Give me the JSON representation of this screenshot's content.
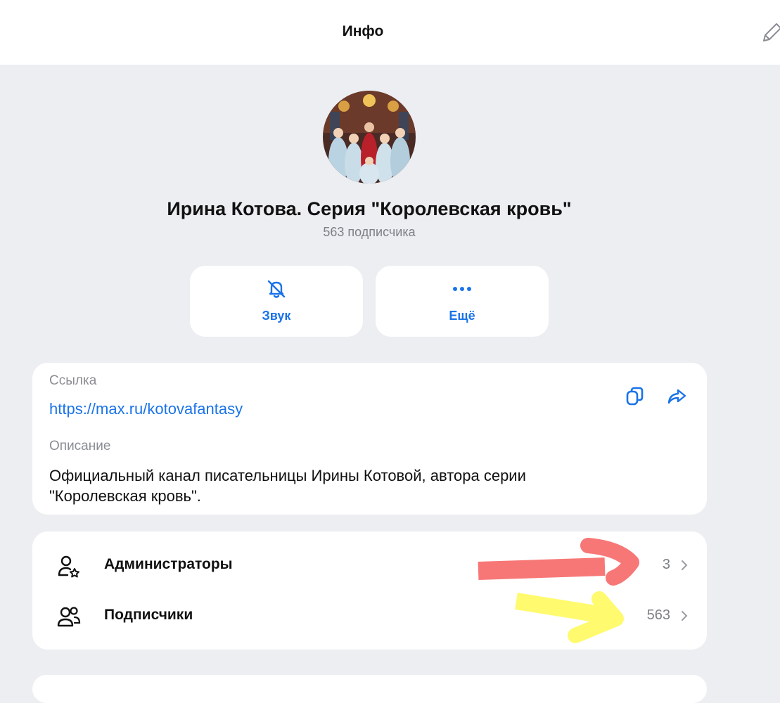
{
  "header": {
    "title": "Инфо"
  },
  "channel": {
    "name": "Ирина Котова. Серия \"Королевская кровь\"",
    "subscribers_text": "563 подписчика"
  },
  "actions": [
    {
      "label": "Звук",
      "icon": "bell-off-icon"
    },
    {
      "label": "Ещё",
      "icon": "more-dots-icon"
    }
  ],
  "info": {
    "link_label": "Ссылка",
    "link_value": "https://max.ru/kotovafantasy",
    "description_label": "Описание",
    "description_value": "Официальный канал писательницы Ирины Котовой, автора серии \"Королевская кровь\"."
  },
  "members": [
    {
      "label": "Администраторы",
      "count": "3",
      "icon": "admin-icon"
    },
    {
      "label": "Подписчики",
      "count": "563",
      "icon": "subscribers-icon"
    }
  ],
  "colors": {
    "accent": "#1a73e8",
    "background": "#edeef2",
    "annotation_red": "#f77777",
    "annotation_yellow": "#fffa6e"
  }
}
